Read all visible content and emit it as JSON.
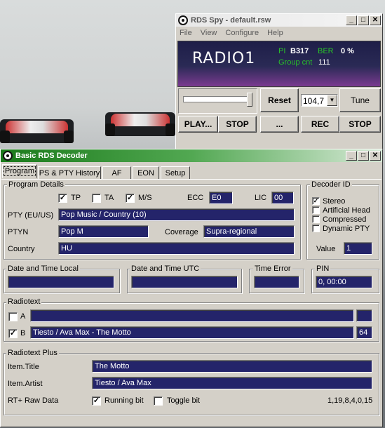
{
  "spy": {
    "title": "RDS Spy - default.rsw",
    "menu": [
      "File",
      "View",
      "Configure",
      "Help"
    ],
    "station": "RADIO1",
    "pi_label": "PI",
    "pi_value": "B317",
    "ber_label": "BER",
    "ber_value": "0 %",
    "group_label": "Group cnt",
    "group_value": "111",
    "reset": "Reset",
    "freq": "104,7",
    "tune": "Tune",
    "play": "PLAY...",
    "stop1": "STOP",
    "dots": "...",
    "rec": "REC",
    "stop2": "STOP",
    "colors": {
      "display_bg": "#20204a",
      "pi_label": "#29c229",
      "accent": "#8a3a9e"
    }
  },
  "decoder": {
    "title": "Basic RDS Decoder",
    "tabs": [
      "Program",
      "PS & PTY History",
      "AF",
      "EON",
      "Setup"
    ],
    "program_details": {
      "label": "Program Details",
      "tp": "TP",
      "ta": "TA",
      "ms": "M/S",
      "ecc_label": "ECC",
      "ecc": "E0",
      "lic_label": "LIC",
      "lic": "00",
      "pty_label": "PTY (EU/US)",
      "pty": "Pop Music / Country (10)",
      "ptyn_label": "PTYN",
      "ptyn": "Pop M",
      "coverage_label": "Coverage",
      "coverage": "Supra-regional",
      "country_label": "Country",
      "country": "HU"
    },
    "decoder_id": {
      "label": "Decoder ID",
      "stereo": "Stereo",
      "artificial": "Artificial Head",
      "compressed": "Compressed",
      "dynamic": "Dynamic PTY",
      "value_label": "Value",
      "value": "1"
    },
    "dt_local": "Date and Time Local",
    "dt_utc": "Date and Time UTC",
    "time_error": "Time Error",
    "pin_label": "PIN",
    "pin": "0, 00:00",
    "radiotext": {
      "label": "Radiotext",
      "a": "A",
      "b": "B",
      "b_text": "Tiesto / Ava Max - The Motto",
      "b_len": "64"
    },
    "rtplus": {
      "label": "Radiotext Plus",
      "title_label": "Item.Title",
      "title": "The Motto",
      "artist_label": "Item.Artist",
      "artist": "Tiesto / Ava Max",
      "raw_label": "RT+ Raw Data",
      "running": "Running bit",
      "toggle": "Toggle bit",
      "raw": "1,19,8,4,0,15"
    }
  }
}
